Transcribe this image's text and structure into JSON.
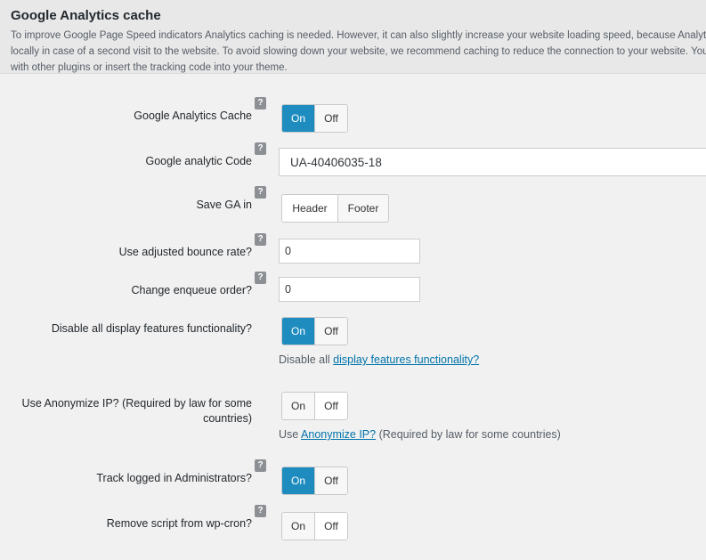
{
  "header": {
    "title": "Google Analytics cache",
    "description": "To improve Google Page Speed indicators Analytics caching is needed. However, it can also slightly increase your website loading speed, because Analytics js files will load locally in case of a second visit to the website. To avoid slowing down your website, we recommend caching to reduce the connection to your website. You do not need to do this with other plugins or insert the tracking code into your theme."
  },
  "help_glyph": "?",
  "settings": {
    "ga_cache": {
      "label": "Google Analytics Cache",
      "on": "On",
      "off": "Off",
      "value": "On"
    },
    "ga_code": {
      "label": "Google analytic Code",
      "value": "UA-40406035-18"
    },
    "save_ga_in": {
      "label": "Save GA in",
      "header": "Header",
      "footer": "Footer",
      "value": "Header"
    },
    "bounce_rate": {
      "label": "Use adjusted bounce rate?",
      "value": "0"
    },
    "enqueue_order": {
      "label": "Change enqueue order?",
      "value": "0"
    },
    "display_features": {
      "label": "Disable all display features functionality?",
      "on": "On",
      "off": "Off",
      "value": "On",
      "note_prefix": "Disable all",
      "note_link": "display features functionality?"
    },
    "anonymize_ip": {
      "label": "Use Anonymize IP? (Required by law for some countries)",
      "on": "On",
      "off": "Off",
      "value": "Off",
      "note_prefix": "Use",
      "note_link": "Anonymize IP?",
      "note_suffix": "(Required by law for some countries)"
    },
    "track_admins": {
      "label": "Track logged in Administrators?",
      "on": "On",
      "off": "Off",
      "value": "On"
    },
    "remove_wpcron": {
      "label": "Remove script from wp-cron?",
      "on": "On",
      "off": "Off",
      "value": "Off"
    }
  },
  "colors": {
    "accent": "#1e8cbe",
    "help_badge": "#8c8f94",
    "link": "#0073aa"
  }
}
